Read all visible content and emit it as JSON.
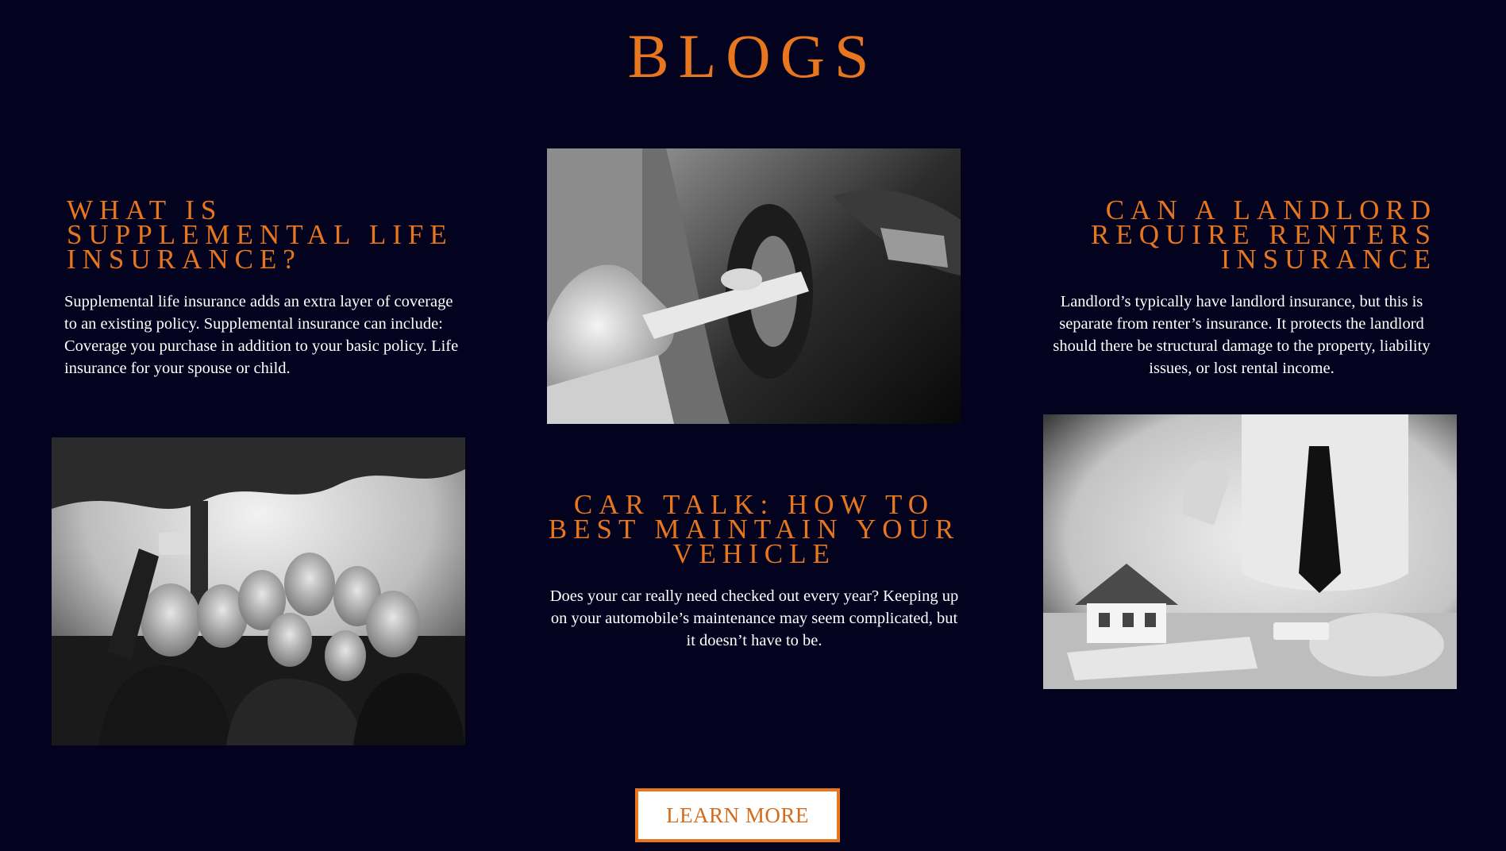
{
  "page": {
    "title": "BLOGS"
  },
  "posts": [
    {
      "title": "WHAT IS SUPPLEMENTAL LIFE INSURANCE?",
      "text": "Supplemental life insurance adds an extra layer of coverage to an existing policy. Supplemental insurance can include: Coverage you purchase in addition to your basic policy. Life insurance for your spouse or child."
    },
    {
      "title": "CAR TALK: HOW TO BEST MAINTAIN YOUR VEHICLE",
      "text": "Does your car really need checked out every year? Keeping up on your automobile’s maintenance may seem complicated, but it doesn’t have to be."
    },
    {
      "title": "CAN A LANDLORD REQUIRE RENTERS INSURANCE",
      "text": "Landlord’s typically have landlord insurance, but this is separate from renter’s insurance. It protects the landlord should there be structural damage to the property, liability issues, or lost rental income."
    }
  ],
  "cta": {
    "label": "LEARN MORE"
  },
  "colors": {
    "background": "#03031f",
    "accent": "#e8761f",
    "text": "#ffffff"
  }
}
